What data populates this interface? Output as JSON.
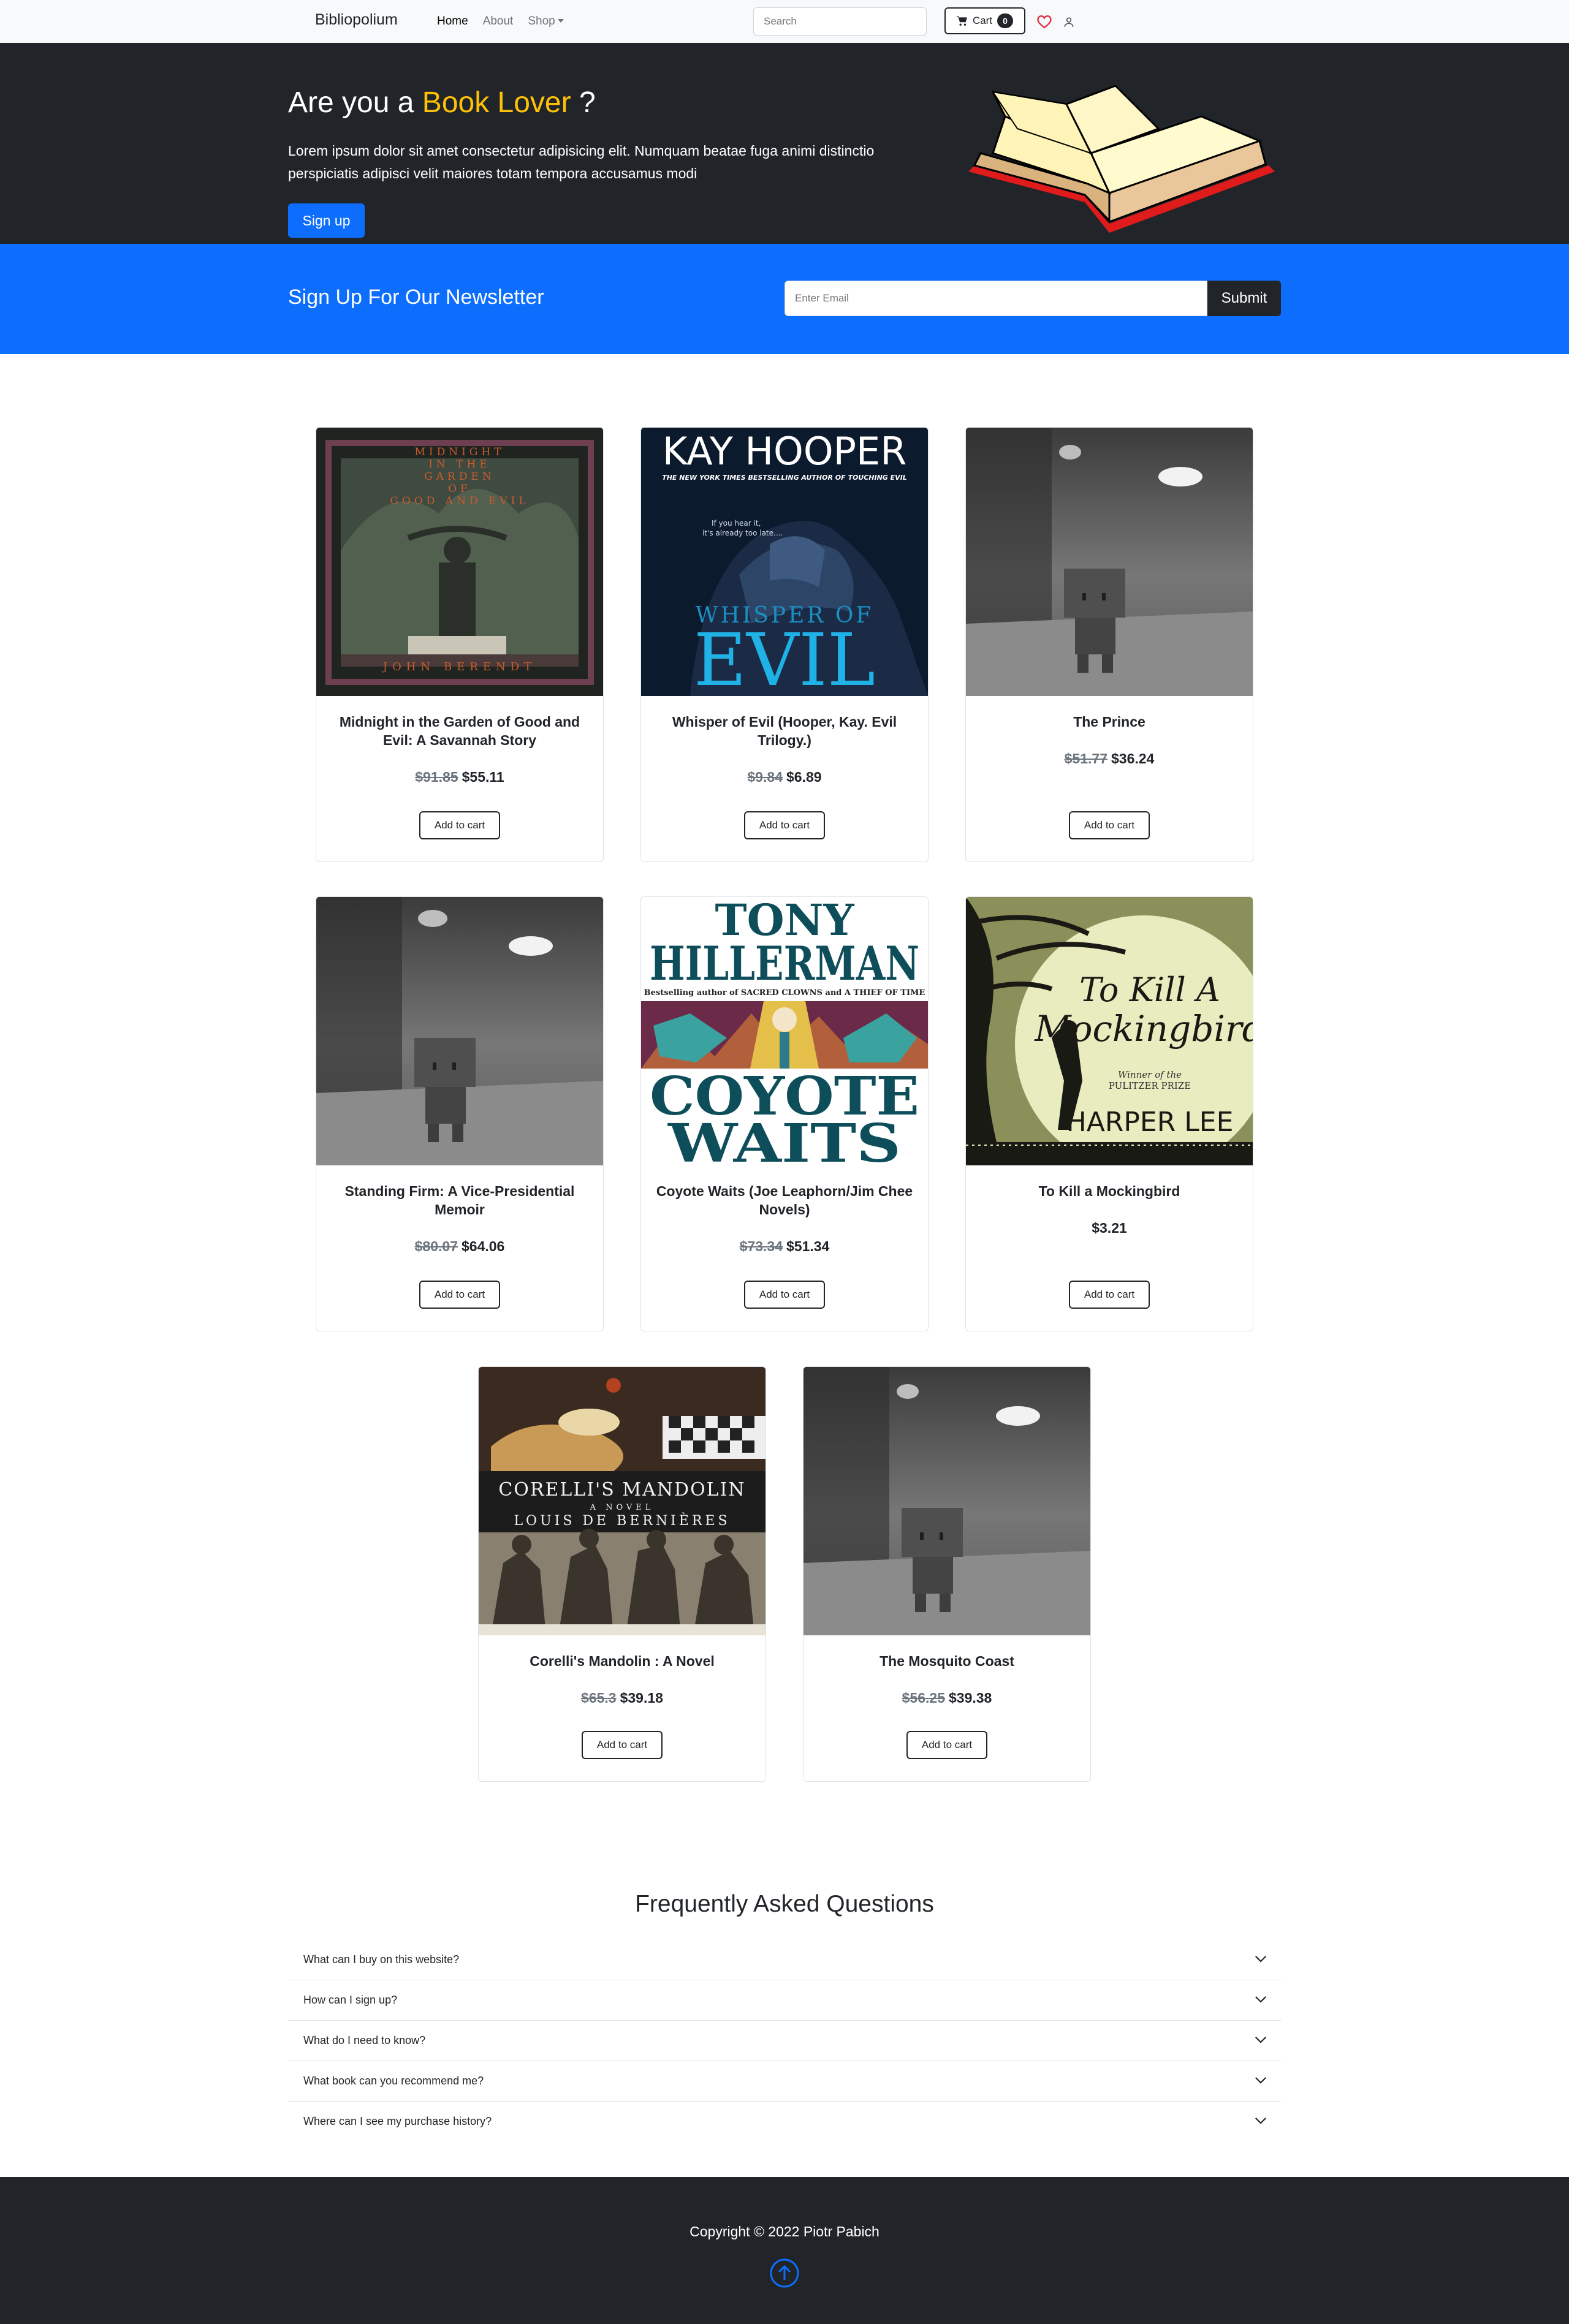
{
  "navbar": {
    "brand": "Bibliopolium",
    "links": [
      {
        "label": "Home",
        "active": true
      },
      {
        "label": "About",
        "active": false
      },
      {
        "label": "Shop",
        "active": false
      }
    ],
    "search_placeholder": "Search",
    "cart_label": "Cart",
    "cart_count": "0",
    "icons": [
      "cart-icon",
      "heart-icon",
      "user-icon"
    ]
  },
  "hero": {
    "title_prefix": "Are you a ",
    "title_accent": "Book Lover",
    "title_suffix": " ?",
    "text": "Lorem ipsum dolor sit amet consectetur adipisicing elit. Numquam beatae fuga animi distinctio perspiciatis adipisci velit maiores totam tempora accusamus modi",
    "signup_label": "Sign up",
    "accent_color": "#ffc107"
  },
  "newsletter": {
    "title": "Sign Up For Our Newsletter",
    "email_placeholder": "Enter Email",
    "submit_label": "Submit"
  },
  "products": [
    {
      "title": "Midnight in the Garden of Good and Evil: A Savannah Story",
      "old_price": "$91.85",
      "price": "$55.11",
      "cover": "Midnight in the Garden of Good and Evil cover",
      "cover_text": [
        "MIDNIGHT",
        "IN THE",
        "GARDEN",
        "OF",
        "GOOD AND EVIL",
        "JOHN BERENDT"
      ]
    },
    {
      "title": "Whisper of Evil (Hooper, Kay. Evil Trilogy.)",
      "old_price": "$9.84",
      "price": "$6.89",
      "cover": "Whisper of Evil cover",
      "cover_text": [
        "KAY HOOPER",
        "THE NEW YORK TIMES BESTSELLING AUTHOR OF TOUCHING EVIL",
        "If you hear it,",
        "it's already too late....",
        "WHISPER OF",
        "EVIL"
      ]
    },
    {
      "title": "The Prince",
      "old_price": "$51.77",
      "price": "$36.24",
      "cover": "placeholder robot photo"
    },
    {
      "title": "Standing Firm: A Vice-Presidential Memoir",
      "old_price": "$80.07",
      "price": "$64.06",
      "cover": "placeholder robot photo"
    },
    {
      "title": "Coyote Waits (Joe Leaphorn/Jim Chee Novels)",
      "old_price": "$73.34",
      "price": "$51.34",
      "cover": "Coyote Waits cover",
      "cover_text": [
        "TONY",
        "HILLERMAN",
        "Bestselling author of SACRED CLOWNS and A THIEF OF TIME",
        "COYOTE",
        "WAITS"
      ]
    },
    {
      "title": "To Kill a Mockingbird",
      "old_price": "",
      "price": "$3.21",
      "cover": "To Kill a Mockingbird cover",
      "cover_text": [
        "To Kill A",
        "Mockingbird",
        "Winner of the",
        "PULITZER PRIZE",
        "HARPER LEE"
      ]
    },
    {
      "title": "Corelli's Mandolin : A Novel",
      "old_price": "$65.3",
      "price": "$39.18",
      "cover": "Corelli's Mandolin cover",
      "cover_text": [
        "CORELLI'S MANDOLIN",
        "A NOVEL",
        "LOUIS DE BERNIÈRES"
      ]
    },
    {
      "title": "The Mosquito Coast",
      "old_price": "$56.25",
      "price": "$39.38",
      "cover": "placeholder robot photo"
    }
  ],
  "add_to_cart_label": "Add to cart",
  "faq": {
    "title": "Frequently Asked Questions",
    "items": [
      "What can I buy on this website?",
      "How can I sign up?",
      "What do I need to know?",
      "What book can you recommend me?",
      "Where can I see my purchase history?"
    ]
  },
  "footer": {
    "copyright": "Copyright © 2022 Piotr Pabich",
    "icon": "arrow-up-circle-icon"
  }
}
